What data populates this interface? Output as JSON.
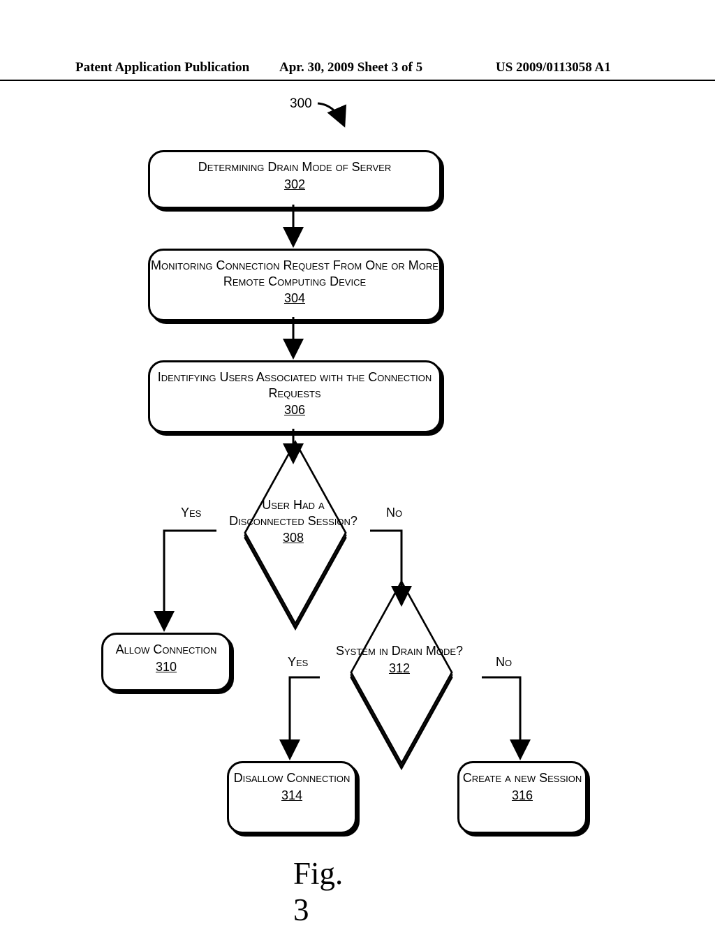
{
  "header": {
    "left": "Patent Application Publication",
    "center": "Apr. 30, 2009  Sheet 3 of 5",
    "right": "US 2009/0113058 A1"
  },
  "refnum": "300",
  "boxes": {
    "b302": {
      "text": "Determining Drain Mode of Server",
      "ref": "302"
    },
    "b304": {
      "text": "Monitoring Connection Request From One or More Remote Computing Device",
      "ref": "304"
    },
    "b306": {
      "text": "Identifying Users Associated with the Connection Requests",
      "ref": "306"
    },
    "b310": {
      "text": "Allow Connection",
      "ref": "310"
    },
    "b314": {
      "text": "Disallow Connection",
      "ref": "314"
    },
    "b316": {
      "text": "Create a new Session",
      "ref": "316"
    }
  },
  "decisions": {
    "d308": {
      "text": "User Had a Disconnected Session?",
      "ref": "308"
    },
    "d312": {
      "text": "System in Drain Mode?",
      "ref": "312"
    }
  },
  "labels": {
    "yes1": "Yes",
    "no1": "No",
    "yes2": "Yes",
    "no2": "No"
  },
  "figure_caption": "Fig. 3"
}
